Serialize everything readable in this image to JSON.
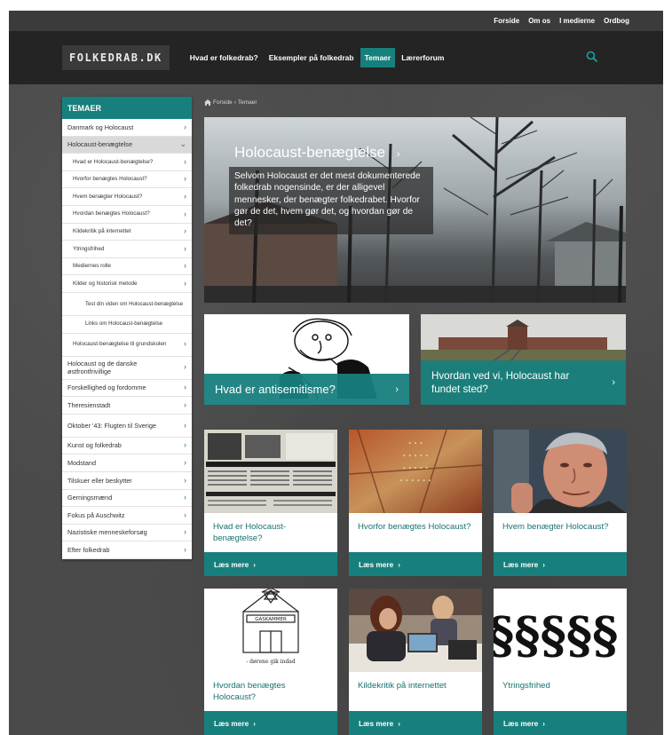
{
  "topnav": [
    "Forside",
    "Om os",
    "I medierne",
    "Ordbog"
  ],
  "logo": "FOLKEDRAB.DK",
  "mainnav": [
    "Hvad er folkedrab?",
    "Eksempler på folkedrab",
    "Temaer",
    "Lærerforum"
  ],
  "sidebar": {
    "title": "TEMAER",
    "items": [
      {
        "label": "Danmark og Holocaust",
        "level": 1
      },
      {
        "label": "Holocaust-benægtelse",
        "level": 1,
        "active": true,
        "expanded": true
      },
      {
        "label": "Hvad er Holocaust-benægtelse?",
        "level": 2
      },
      {
        "label": "Hvorfor benægtes Holocaust?",
        "level": 2
      },
      {
        "label": "Hvem benægter Holocaust?",
        "level": 2
      },
      {
        "label": "Hvordan benægtes Holocaust?",
        "level": 2
      },
      {
        "label": "Kildekritik på internettet",
        "level": 2
      },
      {
        "label": "Ytringsfrihed",
        "level": 2
      },
      {
        "label": "Mediernes rolle",
        "level": 2
      },
      {
        "label": "Kilder og historisk metode",
        "level": 2
      },
      {
        "label": "Test din viden om Holocaust-benægtelse",
        "level": 3
      },
      {
        "label": "Links om Holocaust-benægtelse",
        "level": 3
      },
      {
        "label": "Holocaust-benægtelse til grundskolen",
        "level": 2
      },
      {
        "label": "Holocaust og de danske østfrontfrivillige",
        "level": 1
      },
      {
        "label": "Forskellighed og fordomme",
        "level": 1
      },
      {
        "label": "Theresienstadt",
        "level": 1
      },
      {
        "label": "Oktober '43: Flugten til Sverige",
        "level": 1
      },
      {
        "label": "Kunst og folkedrab",
        "level": 1
      },
      {
        "label": "Modstand",
        "level": 1
      },
      {
        "label": "Tilskuer eller beskytter",
        "level": 1
      },
      {
        "label": "Gerningsmænd",
        "level": 1
      },
      {
        "label": "Fokus på Auschwitz",
        "level": 1
      },
      {
        "label": "Nazistiske menneskeforsøg",
        "level": 1
      },
      {
        "label": "Efter folkedrab",
        "level": 1
      }
    ]
  },
  "breadcrumb": {
    "home": "Forside",
    "separator": "›",
    "current": "Temaer"
  },
  "hero": {
    "title": "Holocaust-benægtelse",
    "text": "Selvom Holocaust er det mest dokumenterede folkedrab nogensinde, er der alligevel mennesker, der benægter folkedrabet. Hvorfor gør de det, hvem gør det, og hvordan gør de det?"
  },
  "features": [
    {
      "title": "Hvad er antisemitisme?"
    },
    {
      "title": "Hvordan ved vi, Holocaust har fundet sted?"
    }
  ],
  "cards": [
    {
      "title": "Hvad er Holocaust-benægtelse?",
      "image": "newspaper-clippings"
    },
    {
      "title": "Hvorfor benægtes Holocaust?",
      "image": "painting-text"
    },
    {
      "title": "Hvem benægter Holocaust?",
      "image": "portrait-man"
    },
    {
      "title": "Hvordan benægtes Holocaust?",
      "image": "gaskammer-drawing",
      "image_text": [
        "GASKAMMER",
        "- dørene gik indad"
      ]
    },
    {
      "title": "Kildekritik på internettet",
      "image": "students-laptops"
    },
    {
      "title": "Ytringsfrihed",
      "image": "paragraph-signs",
      "image_text": [
        "§§§§§"
      ]
    }
  ],
  "more_label": "Læs mere",
  "colors": {
    "teal": "#17807d",
    "dark": "#242424",
    "bg": "#4a4a4a"
  }
}
